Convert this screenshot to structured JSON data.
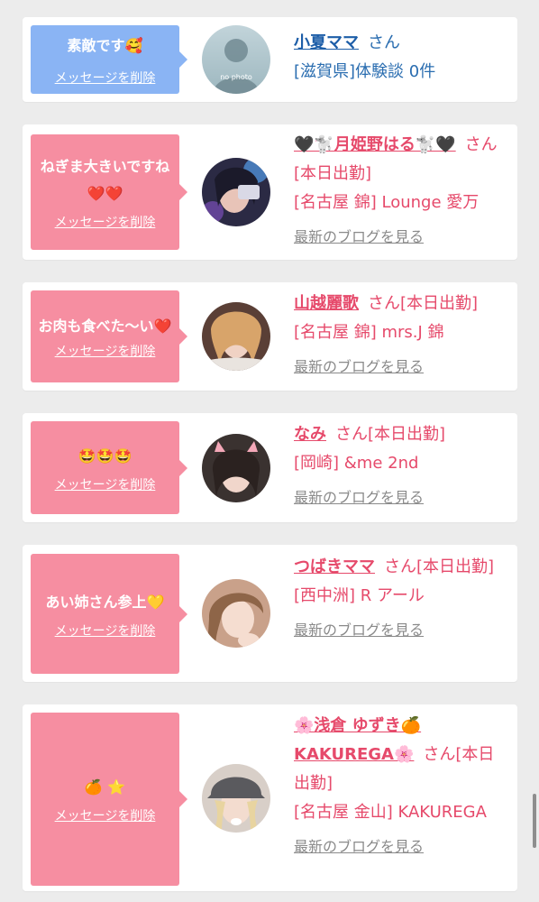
{
  "messages": [
    {
      "bubble_text": "素敵です🥰",
      "delete_label": "メッセージを削除",
      "name": "小夏ママ",
      "suffix": "さん",
      "store": "[滋賀県]体験談 0件",
      "blog_label": ""
    },
    {
      "bubble_text": "ねぎま大きいですね❤️❤️",
      "delete_label": "メッセージを削除",
      "name": "🖤🐩月姫野はる🐩🖤",
      "suffix": "さん[本日出勤]",
      "store": "[名古屋 錦] Lounge 愛万",
      "blog_label": "最新のブログを見る"
    },
    {
      "bubble_text": "お肉も食べた〜い❤️",
      "delete_label": "メッセージを削除",
      "name": "山越麗歌",
      "suffix": "さん[本日出勤]",
      "store": "[名古屋 錦] mrs.J 錦",
      "blog_label": "最新のブログを見る"
    },
    {
      "bubble_text": "🤩🤩🤩",
      "delete_label": "メッセージを削除",
      "name": "なみ",
      "suffix": "さん[本日出勤]",
      "store": "[岡崎] &me 2nd",
      "blog_label": "最新のブログを見る"
    },
    {
      "bubble_text": "あい姉さん参上💛",
      "delete_label": "メッセージを削除",
      "name": "つばきママ",
      "suffix": "さん[本日出勤]",
      "store": "[西中洲] R アール",
      "blog_label": "最新のブログを見る"
    },
    {
      "bubble_text": "🍊 ⭐",
      "delete_label": "メッセージを削除",
      "name": "🌸浅倉 ゆずき🍊KAKUREGA🌸",
      "suffix": "さん[本日出勤]",
      "store": "[名古屋 金山] KAKUREGA",
      "blog_label": "最新のブログを見る"
    }
  ],
  "avatar_placeholder_text": "no photo",
  "colors": {
    "page_bg": "#ececec",
    "card_bg": "#ffffff",
    "bubble_blue": "#8ab4f4",
    "bubble_pink": "#f68ea1",
    "cast_name_pink": "#e64a6b",
    "user_name_blue": "#1d5ea8",
    "blog_link_gray": "#8a8a8a"
  },
  "icons": {
    "avatar_placeholder": "user-silhouette-icon",
    "avatar_photo": "profile-photo-icon"
  }
}
